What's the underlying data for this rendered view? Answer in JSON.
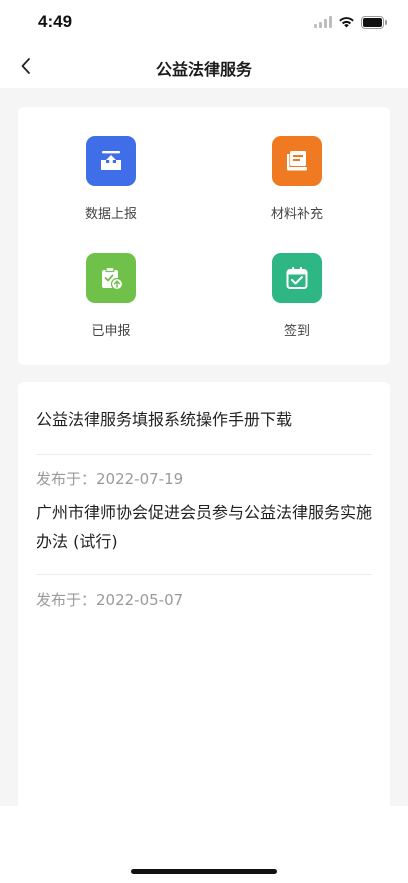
{
  "status_bar": {
    "time": "4:49"
  },
  "nav": {
    "title": "公益法律服务"
  },
  "menu": {
    "items": [
      {
        "label": "数据上报",
        "icon": "upload-tray-icon",
        "color": "#3f6ee8"
      },
      {
        "label": "材料补充",
        "icon": "document-book-icon",
        "color": "#f07a22"
      },
      {
        "label": "已申报",
        "icon": "clipboard-upload-icon",
        "color": "#6fc14a"
      },
      {
        "label": "签到",
        "icon": "calendar-check-icon",
        "color": "#2eb685"
      }
    ]
  },
  "notices": [
    {
      "title": "公益法律服务填报系统操作手册下载",
      "date": "发布于：2022-07-19"
    },
    {
      "title": "广州市律师协会促进会员参与公益法律服务实施办法 (试行)",
      "date": "发布于：2022-05-07"
    }
  ]
}
